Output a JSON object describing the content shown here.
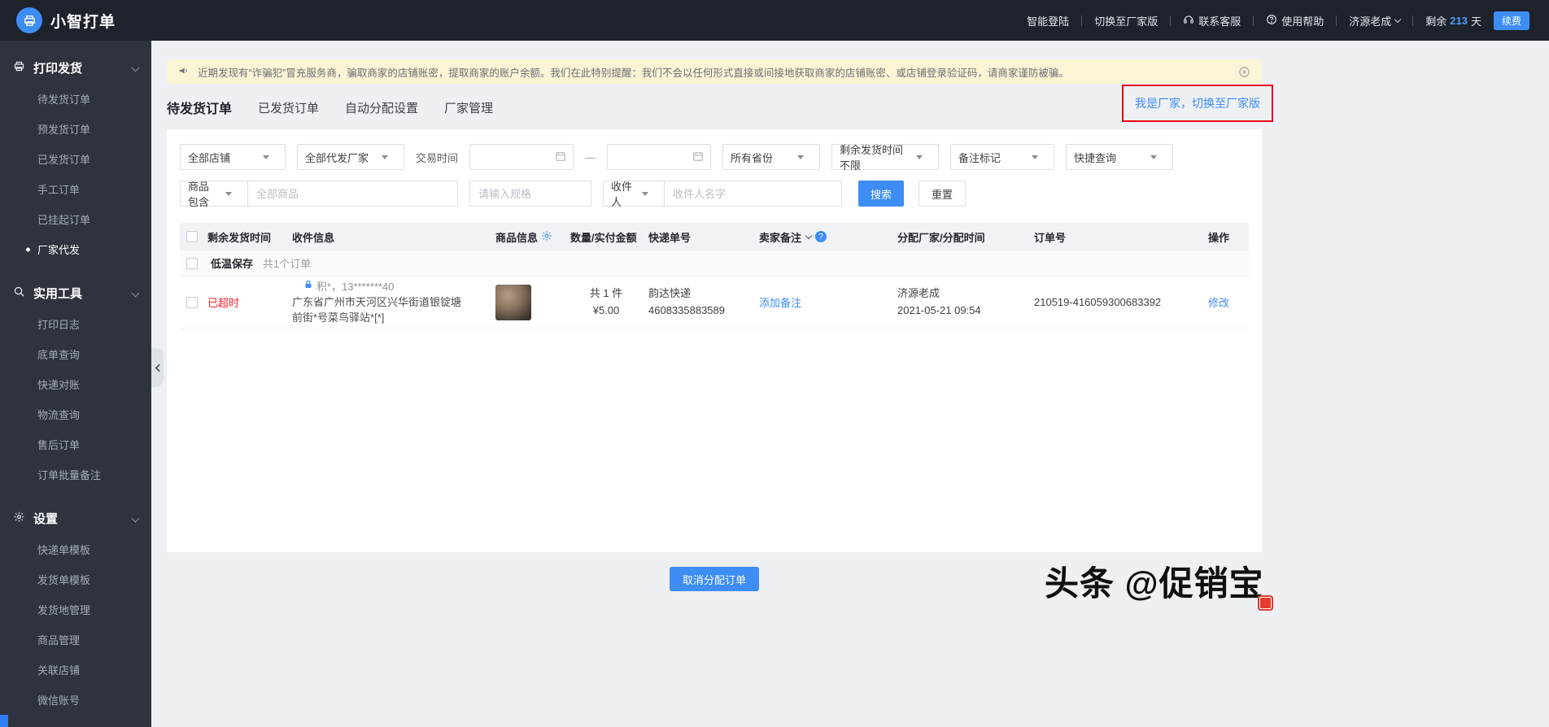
{
  "colors": {
    "accent": "#3d8df5",
    "danger": "#f5222d",
    "highlight-box": "#e60012",
    "topbar-bg": "#1d222b",
    "sidebar-bg": "#2e333d",
    "page-bg": "#eef0f4",
    "notice-bg": "#fbf4d5"
  },
  "icons": {
    "logo": "printer-icon",
    "notice": "megaphone-icon",
    "notice_close": "close-circle-icon",
    "contact": "headset-icon",
    "help": "question-circle-icon",
    "product_settings": "gear-icon",
    "recipient_privacy": "lock-icon",
    "date": "calendar-icon"
  },
  "topbar": {
    "logo_text": "小智打单",
    "items": [
      "智能登陆",
      "切换至厂家版",
      "联系客服",
      "使用帮助"
    ],
    "user": "济源老成",
    "remain_prefix": "剩余",
    "remain_days": "213",
    "remain_suffix": "天",
    "renew": "续费"
  },
  "sidebar": {
    "sections": [
      {
        "title": "打印发货",
        "icon": "printer-icon",
        "items": [
          "待发货订单",
          "预发货订单",
          "已发货订单",
          "手工订单",
          "已挂起订单",
          "厂家代发"
        ],
        "active_item": "厂家代发"
      },
      {
        "title": "实用工具",
        "icon": "magnifier-icon",
        "items": [
          "打印日志",
          "底单查询",
          "快递对账",
          "物流查询",
          "售后订单",
          "订单批量备注"
        ]
      },
      {
        "title": "设置",
        "icon": "gear-icon",
        "items": [
          "快递单模板",
          "发货单模板",
          "发货地管理",
          "商品管理",
          "关联店铺",
          "微信账号"
        ]
      }
    ]
  },
  "notice": {
    "text": "近期发现有“诈骗犯”冒充服务商，骗取商家的店铺账密，提取商家的账户余额。我们在此特别提醒：我们不会以任何形式直接或间接地获取商家的店铺账密、或店铺登录验证码，请商家谨防被骗。"
  },
  "tabs": [
    "待发货订单",
    "已发货订单",
    "自动分配设置",
    "厂家管理"
  ],
  "switch_link": "我是厂家，切换至厂家版",
  "filters": {
    "shop": "全部店铺",
    "factory": "全部代发厂家",
    "trade_time_label": "交易时间",
    "date_separator": "—",
    "province": "所有省份",
    "remain_time": "剩余发货时间不限",
    "remark_tag": "备注标记",
    "quick_query": "快捷查询",
    "product_contains": "商品包含",
    "product_placeholder": "全部商品",
    "spec_placeholder": "请输入规格",
    "recipient": "收件人",
    "recipient_placeholder": "收件人名字",
    "search": "搜索",
    "reset": "重置"
  },
  "table": {
    "headers": [
      "剩余发货时间",
      "收件信息",
      "商品信息",
      "数量/实付金额",
      "快递单号",
      "卖家备注",
      "分配厂家/分配时间",
      "订单号",
      "操作"
    ],
    "help_icon_glyph": "?",
    "group": {
      "tag": "低温保存",
      "count": "共1个订单"
    },
    "row": {
      "status": "已超时",
      "recipient_name": "积*，13*******40",
      "address": "广东省广州市天河区兴华街道银锭塘前街*号菜鸟驿站*[*]",
      "qty": "共 1 件",
      "amount": "¥5.00",
      "courier": "韵达快递",
      "tracking_no": "4608335883589",
      "remark_action": "添加备注",
      "factory_name": "济源老成",
      "assign_time": "2021-05-21 09:54",
      "order_no": "210519-416059300683392",
      "action": "修改"
    }
  },
  "footer": {
    "cancel_button": "取消分配订单"
  },
  "watermark": "头条 @促销宝"
}
